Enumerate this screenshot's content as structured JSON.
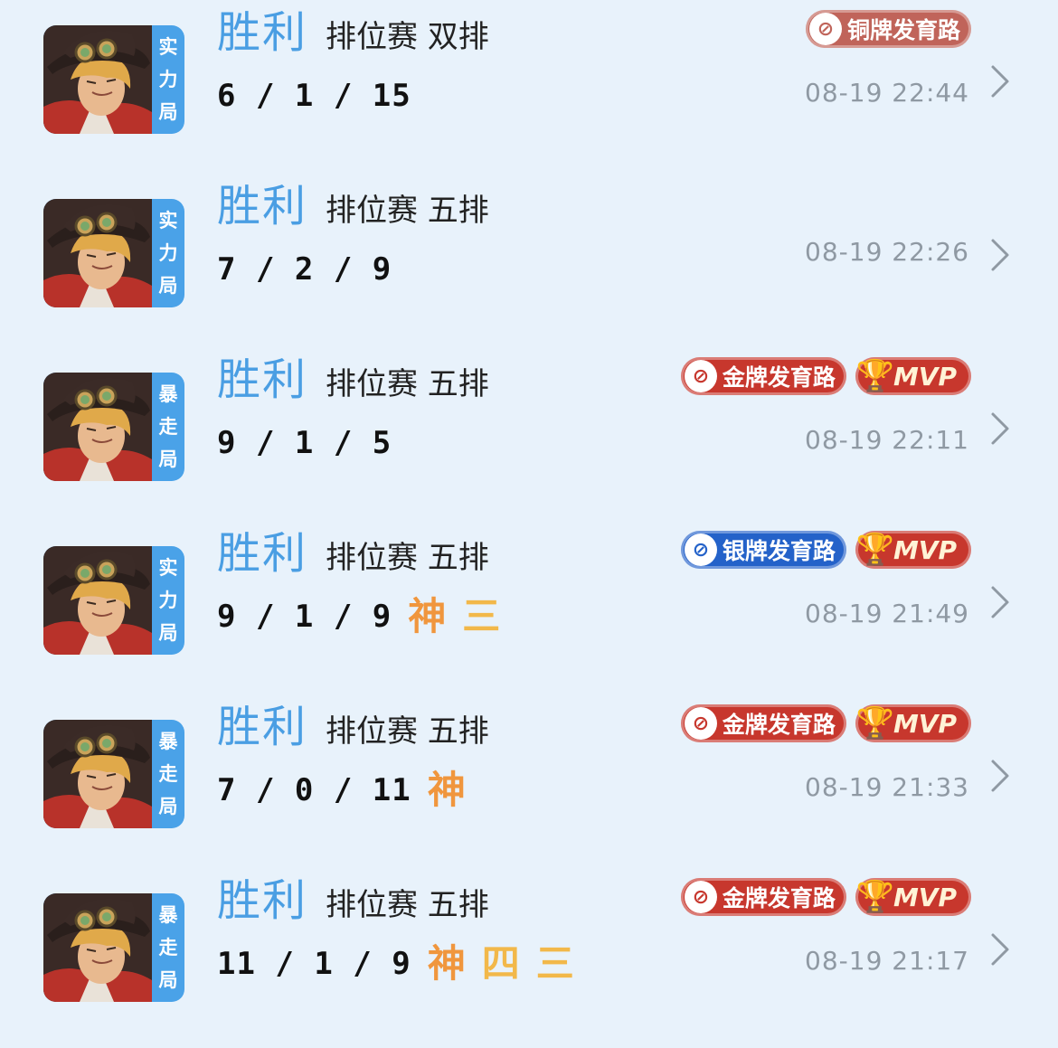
{
  "colors": {
    "background": "#e8f2fb",
    "result_win": "#4a9ee3",
    "mode_tag_bg": "#4aa2e8",
    "time_text": "#8f99a3",
    "badge_bronze": "#c0645a",
    "badge_gold": "#c7372d",
    "badge_silver": "#2462c9",
    "badge_mvp": "#c7372d",
    "honor_text": "#f2b84a"
  },
  "matches": [
    {
      "mode_tag": [
        "实",
        "力",
        "局"
      ],
      "result": "胜利",
      "match_type": "排位赛 双排",
      "kda": "6 / 1 / 15",
      "honors": [],
      "badges": [
        {
          "kind": "bronze",
          "label": "铜牌发育路",
          "icon": "lane-icon"
        }
      ],
      "time": "08-19 22:44"
    },
    {
      "mode_tag": [
        "实",
        "力",
        "局"
      ],
      "result": "胜利",
      "match_type": "排位赛 五排",
      "kda": "7 / 2 / 9",
      "honors": [],
      "badges": [],
      "time": "08-19 22:26"
    },
    {
      "mode_tag": [
        "暴",
        "走",
        "局"
      ],
      "result": "胜利",
      "match_type": "排位赛 五排",
      "kda": "9 / 1 / 5",
      "honors": [],
      "badges": [
        {
          "kind": "gold",
          "label": "金牌发育路",
          "icon": "lane-icon"
        },
        {
          "kind": "mvp",
          "label": "MVP",
          "icon": "trophy-icon"
        }
      ],
      "time": "08-19 22:11"
    },
    {
      "mode_tag": [
        "实",
        "力",
        "局"
      ],
      "result": "胜利",
      "match_type": "排位赛 五排",
      "kda": "9 / 1 / 9",
      "honors": [
        "神",
        "三"
      ],
      "badges": [
        {
          "kind": "silver",
          "label": "银牌发育路",
          "icon": "lane-icon"
        },
        {
          "kind": "mvp",
          "label": "MVP",
          "icon": "trophy-icon"
        }
      ],
      "time": "08-19 21:49"
    },
    {
      "mode_tag": [
        "暴",
        "走",
        "局"
      ],
      "result": "胜利",
      "match_type": "排位赛 五排",
      "kda": "7 / 0 / 11",
      "honors": [
        "神"
      ],
      "badges": [
        {
          "kind": "gold",
          "label": "金牌发育路",
          "icon": "lane-icon"
        },
        {
          "kind": "mvp",
          "label": "MVP",
          "icon": "trophy-icon"
        }
      ],
      "time": "08-19 21:33"
    },
    {
      "mode_tag": [
        "暴",
        "走",
        "局"
      ],
      "result": "胜利",
      "match_type": "排位赛 五排",
      "kda": "11 / 1 / 9",
      "honors": [
        "神",
        "四",
        "三"
      ],
      "badges": [
        {
          "kind": "gold",
          "label": "金牌发育路",
          "icon": "lane-icon"
        },
        {
          "kind": "mvp",
          "label": "MVP",
          "icon": "trophy-icon"
        }
      ],
      "time": "08-19 21:17"
    }
  ]
}
